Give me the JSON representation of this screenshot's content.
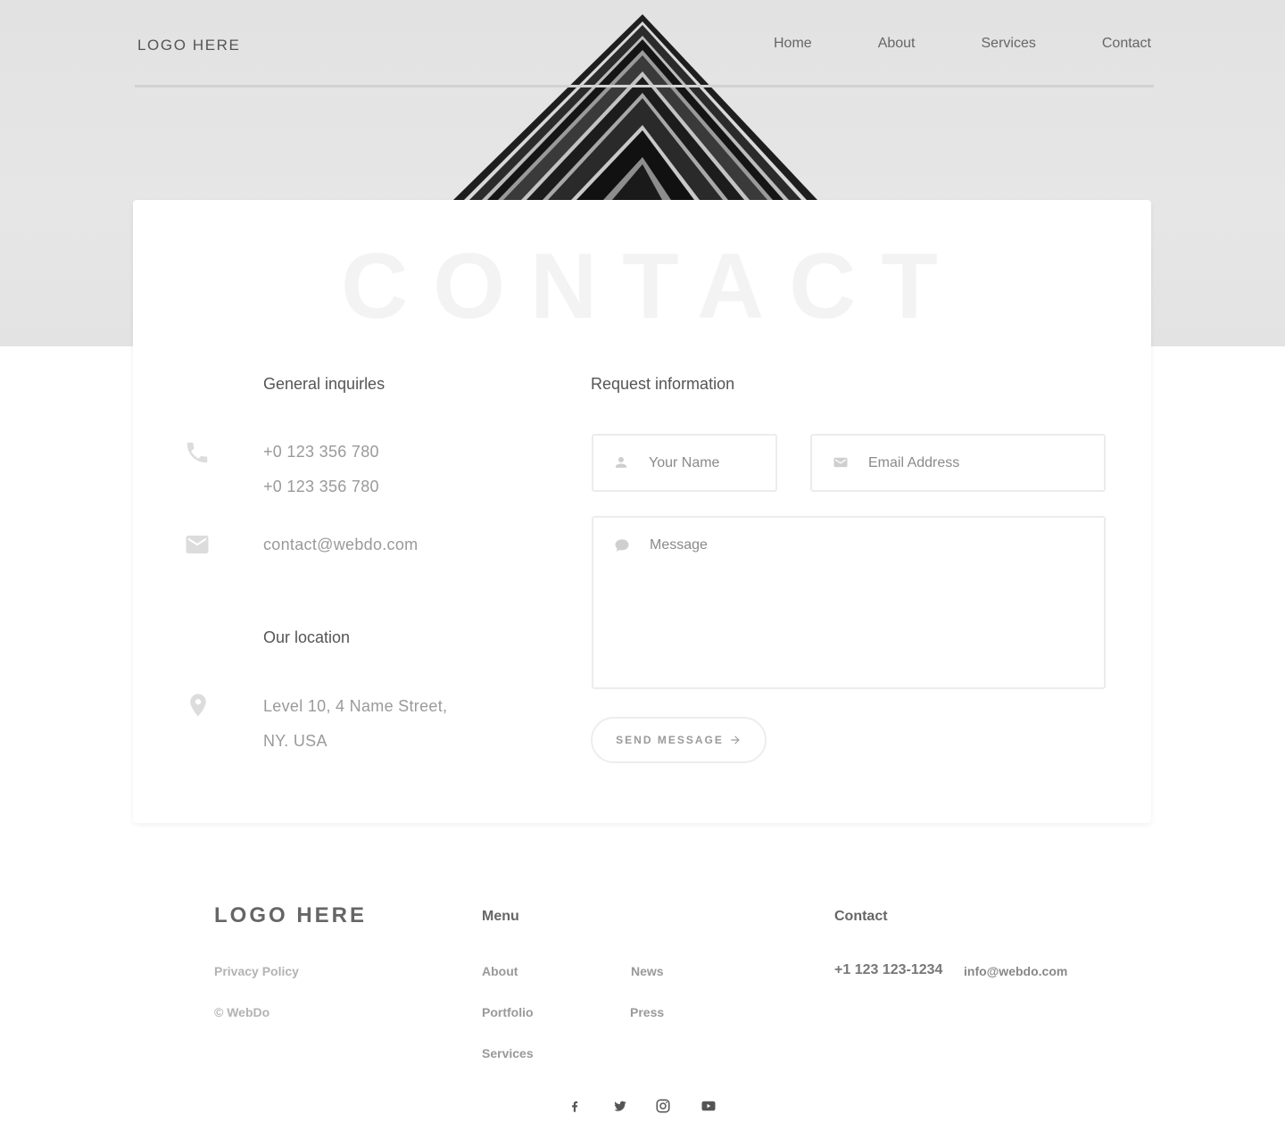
{
  "header": {
    "logo": "LOGO HERE",
    "nav": [
      {
        "label": "Home"
      },
      {
        "label": "About"
      },
      {
        "label": "Services"
      },
      {
        "label": "Contact"
      }
    ]
  },
  "hero": {
    "title": "CONTACT"
  },
  "general": {
    "heading": "General inquirles",
    "phone_1": "+0 123 356 780",
    "phone_2": "+0 123 356 780",
    "email": "contact@webdo.com",
    "phone_icon": "phone-icon",
    "email_icon": "envelope-icon"
  },
  "location": {
    "heading": "Our location",
    "line_1": "Level 10, 4 Name Street,",
    "line_2": "NY. USA",
    "icon": "map-pin-icon"
  },
  "request": {
    "heading": "Request information",
    "name_placeholder": "Your Name",
    "email_placeholder": "Email Address",
    "message_placeholder": "Message",
    "send_label": "SEND MESSAGE"
  },
  "footer": {
    "logo": "LOGO HERE",
    "privacy": "Privacy Policy",
    "copyright": "© WebDo",
    "menu_heading": "Menu",
    "menu": {
      "about": "About",
      "news": "News",
      "portfolio": "Portfolio",
      "press": "Press",
      "services": "Services"
    },
    "contact_heading": "Contact",
    "phone": "+1 123 123-1234",
    "email": "info@webdo.com",
    "social": [
      "facebook-icon",
      "twitter-icon",
      "instagram-icon",
      "youtube-icon"
    ]
  },
  "colors": {
    "hero_bg": "#e3e3e3",
    "text_dark": "#555555",
    "text_muted": "#9a9a9a",
    "border": "#ececec"
  }
}
